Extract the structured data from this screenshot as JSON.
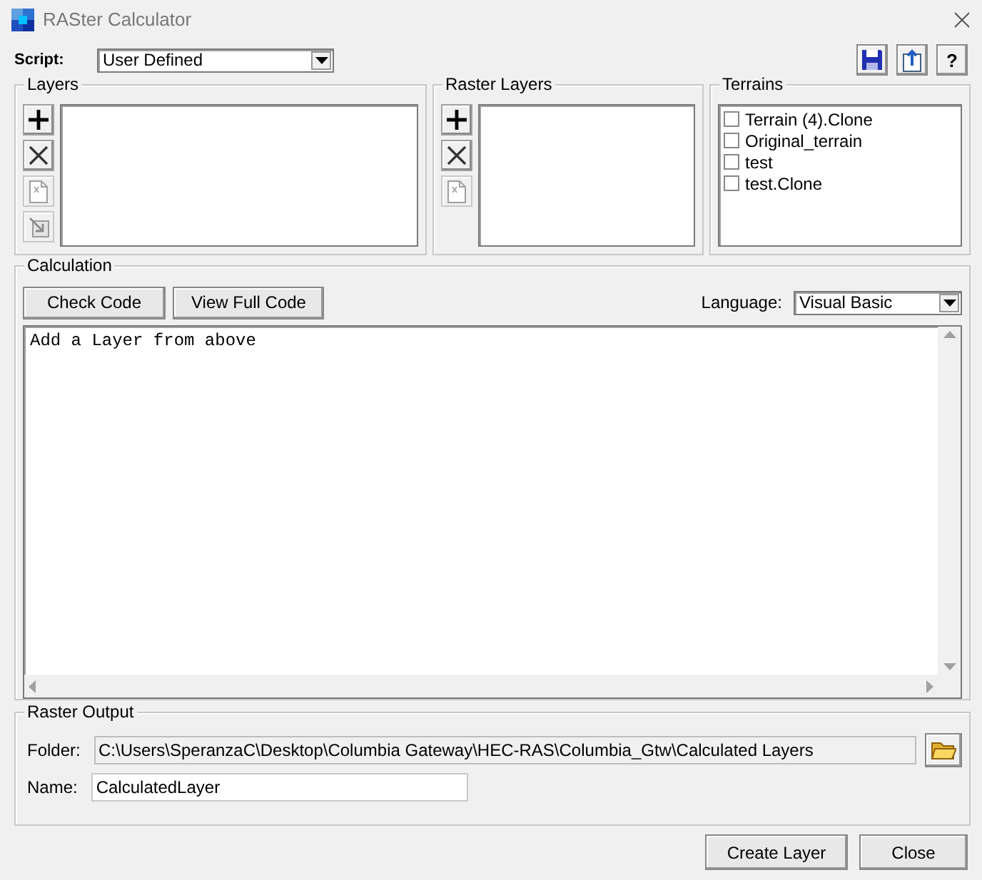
{
  "window": {
    "title": "RASter Calculator"
  },
  "script": {
    "label": "Script:",
    "value": "User Defined"
  },
  "toolbar": [
    {
      "kind": "save"
    },
    {
      "kind": "export"
    },
    {
      "kind": "help",
      "text": "?"
    }
  ],
  "layers": {
    "title": "Layers",
    "buttons": [
      {
        "kind": "add",
        "disabled": false
      },
      {
        "kind": "remove",
        "disabled": false
      },
      {
        "kind": "edit",
        "disabled": true
      },
      {
        "kind": "import",
        "disabled": true
      }
    ]
  },
  "raster_layers": {
    "title": "Raster Layers",
    "buttons": [
      {
        "kind": "add",
        "disabled": false
      },
      {
        "kind": "remove",
        "disabled": false
      },
      {
        "kind": "edit",
        "disabled": true
      }
    ]
  },
  "terrains": {
    "title": "Terrains",
    "items": [
      {
        "label": "Terrain (4).Clone",
        "checked": false
      },
      {
        "label": "Original_terrain",
        "checked": false
      },
      {
        "label": "test",
        "checked": false
      },
      {
        "label": "test.Clone",
        "checked": false
      }
    ]
  },
  "calculation": {
    "title": "Calculation",
    "buttons": [
      "Check Code",
      "View Full Code"
    ],
    "language": {
      "label": "Language:",
      "value": "Visual Basic"
    },
    "code": "Add a Layer from above"
  },
  "raster_output": {
    "title": "Raster Output",
    "folder": {
      "label": "Folder:",
      "value": "C:\\Users\\SperanzaC\\Desktop\\Columbia Gateway\\HEC-RAS\\Columbia_Gtw\\Calculated Layers"
    },
    "name": {
      "label": "Name:",
      "value": "CalculatedLayer"
    }
  },
  "buttons": [
    "Create Layer",
    "Close"
  ]
}
